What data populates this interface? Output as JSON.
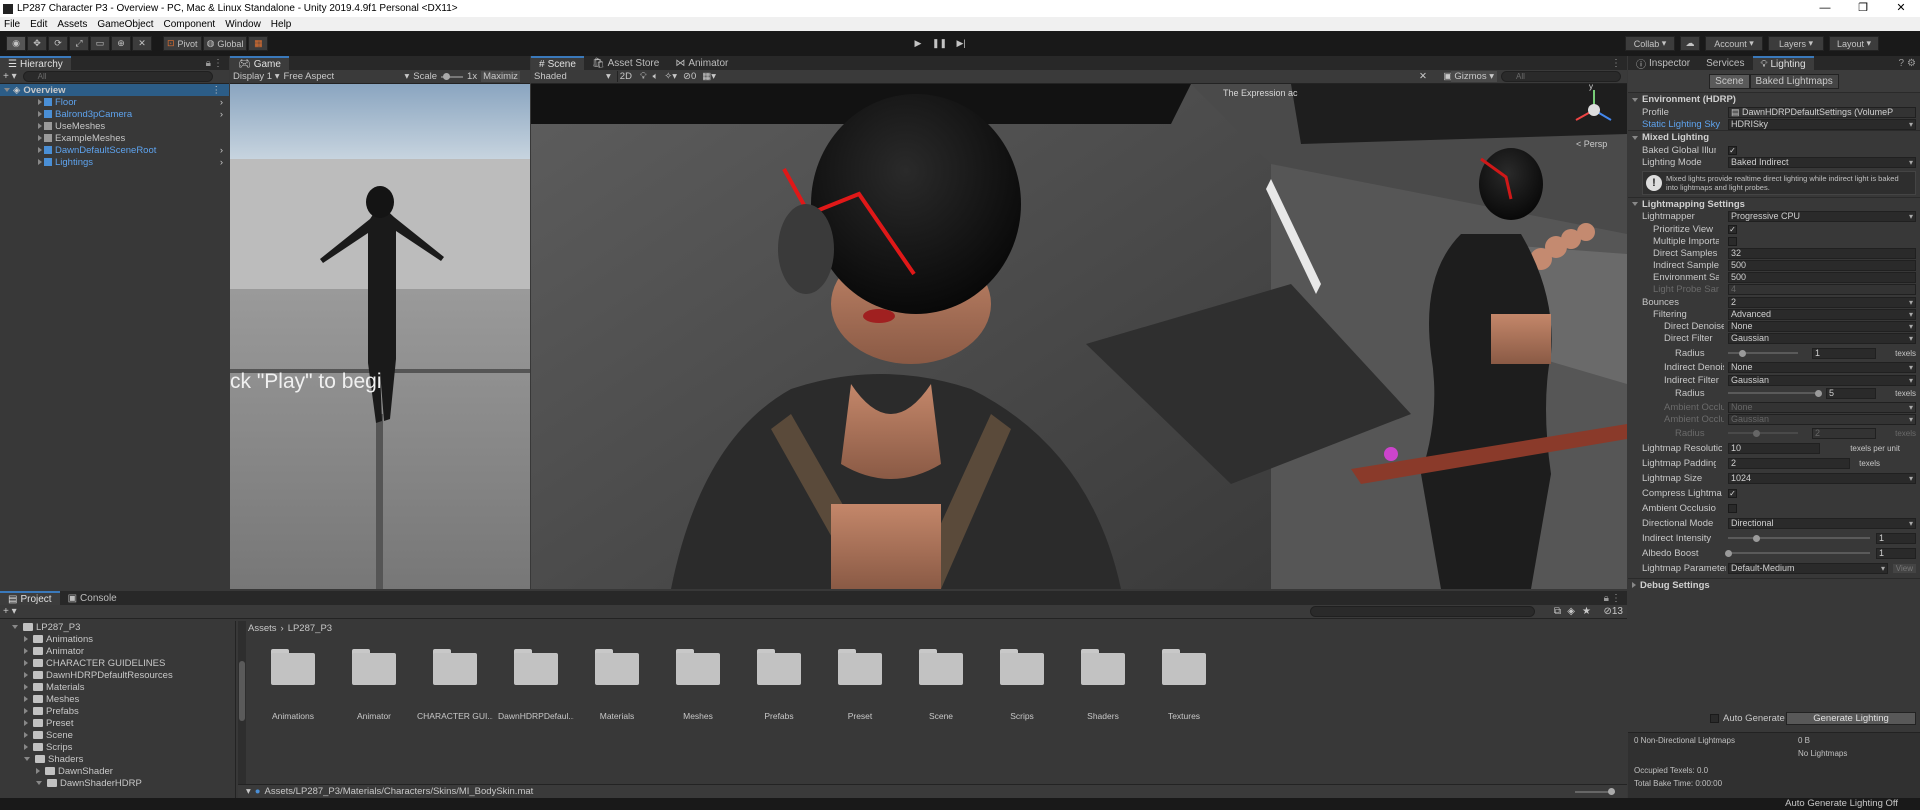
{
  "window": {
    "title": "LP287 Character P3 - Overview - PC, Mac & Linux Standalone - Unity 2019.4.9f1 Personal <DX11>"
  },
  "menu": [
    "File",
    "Edit",
    "Assets",
    "GameObject",
    "Component",
    "Window",
    "Help"
  ],
  "toolbar": {
    "pivot": "Pivot",
    "global": "Global",
    "collab": "Collab",
    "account": "Account",
    "layers": "Layers",
    "layout": "Layout"
  },
  "hierarchy": {
    "tab": "Hierarchy",
    "search": "All",
    "root": "Overview",
    "items": [
      {
        "label": "Floor",
        "blue": true,
        "arrow": true
      },
      {
        "label": "Balrond3pCamera",
        "blue": true,
        "arrow": true
      },
      {
        "label": "UseMeshes",
        "blue": false,
        "arrow": false
      },
      {
        "label": "ExampleMeshes",
        "blue": false,
        "arrow": false
      },
      {
        "label": "DawnDefaultSceneRoot",
        "blue": true,
        "arrow": true
      },
      {
        "label": "Lightings",
        "blue": true,
        "arrow": true
      }
    ]
  },
  "game": {
    "tab": "Game",
    "display": "Display 1",
    "aspect": "Free Aspect",
    "scale": "Scale",
    "scale_value": "1x",
    "maximize": "Maximiz",
    "overlay": "ck \"Play\" to begi"
  },
  "scene": {
    "tabs": [
      "Scene",
      "Asset Store",
      "Animator"
    ],
    "shading": "Shaded",
    "mode2d": "2D",
    "gizmos": "Gizmos",
    "search": "All",
    "persp": "< Persp",
    "counter": "0",
    "overlay": "The Expression ac"
  },
  "inspector": {
    "tabs": [
      "Inspector",
      "Services",
      "Lighting"
    ],
    "subtabs": [
      "Scene",
      "Baked Lightmaps"
    ],
    "env_header": "Environment (HDRP)",
    "profile_label": "Profile",
    "profile_value": "DawnHDRPDefaultSettings (VolumeP",
    "sky_label": "Static Lighting Sky",
    "sky_value": "HDRISky",
    "mixed_header": "Mixed Lighting",
    "baked_gi_label": "Baked Global Illumina",
    "lighting_mode_label": "Lighting Mode",
    "lighting_mode_value": "Baked Indirect",
    "info_text": "Mixed lights provide realtime direct lighting while indirect light is baked into lightmaps and light probes.",
    "lightmapping_header": "Lightmapping Settings",
    "lightmapper_label": "Lightmapper",
    "lightmapper_value": "Progressive CPU",
    "prioritize_label": "Prioritize View",
    "multiple_label": "Multiple Importanc",
    "direct_samples_label": "Direct Samples",
    "direct_samples_value": "32",
    "indirect_samples_label": "Indirect Samples",
    "indirect_samples_value": "500",
    "env_samples_label": "Environment Samp",
    "env_samples_value": "500",
    "probe_samples_label": "Light Probe Sampl",
    "probe_samples_value": "4",
    "bounces_label": "Bounces",
    "bounces_value": "2",
    "filtering_label": "Filtering",
    "filtering_value": "Advanced",
    "direct_denoiser_label": "Direct Denoiser",
    "direct_denoiser_value": "None",
    "direct_filter_label": "Direct Filter",
    "direct_filter_value": "Gaussian",
    "radius_label": "Radius",
    "radius1_value": "1",
    "radius1_fraction": 0.2,
    "texels": "texels",
    "indirect_denoiser_label": "Indirect Denoise",
    "indirect_denoiser_value": "None",
    "indirect_filter_label": "Indirect Filter",
    "indirect_filter_value": "Gaussian",
    "radius2_value": "5",
    "radius2_fraction": 1.0,
    "ao_label": "Ambient Occlus",
    "ao1_value": "None",
    "ao2_value": "Gaussian",
    "radius3_value": "2",
    "radius3_fraction": 0.4,
    "lm_res_label": "Lightmap Resolution",
    "lm_res_value": "10",
    "lm_res_unit": "texels per unit",
    "lm_pad_label": "Lightmap Padding",
    "lm_pad_value": "2",
    "lm_pad_unit": "texels",
    "lm_size_label": "Lightmap Size",
    "lm_size_value": "1024",
    "compress_label": "Compress Lightmaps",
    "ambient_occ_label": "Ambient Occlusion",
    "dir_mode_label": "Directional Mode",
    "dir_mode_value": "Directional",
    "indirect_intensity_label": "Indirect Intensity",
    "indirect_intensity_value": "1",
    "indirect_intensity_fraction": 0.2,
    "albedo_label": "Albedo Boost",
    "albedo_value": "1",
    "albedo_fraction": 0.0,
    "lm_params_label": "Lightmap Parameters",
    "lm_params_value": "Default-Medium",
    "view": "View",
    "debug_header": "Debug Settings",
    "auto_generate": "Auto Generate",
    "generate": "Generate Lighting",
    "stats": {
      "nondir": "0 Non-Directional Lightmaps",
      "size": "0 B",
      "nolm": "No Lightmaps",
      "occupied": "Occupied Texels: 0.0",
      "bake_time": "Total Bake Time: 0:00:00"
    }
  },
  "project": {
    "tabs": [
      "Project",
      "Console"
    ],
    "tree": [
      {
        "label": "LP287_P3",
        "depth": 0,
        "open": true
      },
      {
        "label": "Animations",
        "depth": 1
      },
      {
        "label": "Animator",
        "depth": 1
      },
      {
        "label": "CHARACTER GUIDELINES",
        "depth": 1
      },
      {
        "label": "DawnHDRPDefaultResources",
        "depth": 1
      },
      {
        "label": "Materials",
        "depth": 1
      },
      {
        "label": "Meshes",
        "depth": 1
      },
      {
        "label": "Prefabs",
        "depth": 1
      },
      {
        "label": "Preset",
        "depth": 1
      },
      {
        "label": "Scene",
        "depth": 1
      },
      {
        "label": "Scrips",
        "depth": 1
      },
      {
        "label": "Shaders",
        "depth": 1,
        "open": true
      },
      {
        "label": "DawnShader",
        "depth": 2
      },
      {
        "label": "DawnShaderHDRP",
        "depth": 2,
        "open": true
      }
    ],
    "breadcrumb": [
      "Assets",
      "LP287_P3"
    ],
    "folders": [
      "Animations",
      "Animator",
      "CHARACTER GUI...",
      "DawnHDRPDefaul...",
      "Materials",
      "Meshes",
      "Prefabs",
      "Preset",
      "Scene",
      "Scrips",
      "Shaders",
      "Textures"
    ],
    "selected_path": "Assets/LP287_P3/Materials/Characters/Skins/MI_BodySkin.mat",
    "count": "13"
  },
  "status": {
    "text": "Auto Generate Lighting Off"
  }
}
